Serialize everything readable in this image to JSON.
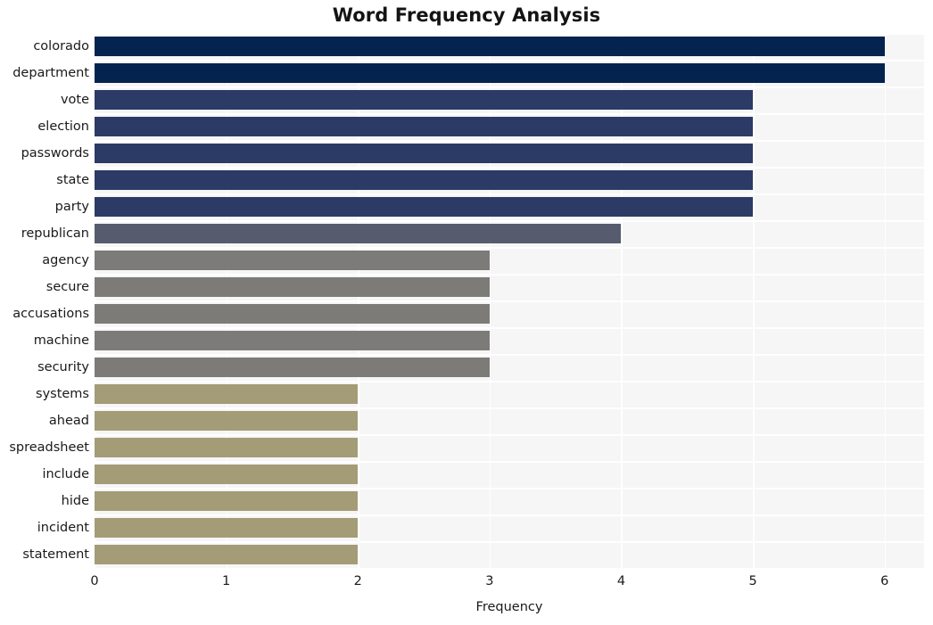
{
  "chart_data": {
    "type": "bar",
    "orientation": "horizontal",
    "title": "Word Frequency Analysis",
    "xlabel": "Frequency",
    "ylabel": "",
    "xlim": [
      0,
      6.3
    ],
    "xticks": [
      0,
      1,
      2,
      3,
      4,
      5,
      6
    ],
    "xtick_labels": [
      "0",
      "1",
      "2",
      "3",
      "4",
      "5",
      "6"
    ],
    "grid": true,
    "legend": false,
    "categories": [
      "colorado",
      "department",
      "vote",
      "election",
      "passwords",
      "state",
      "party",
      "republican",
      "agency",
      "secure",
      "accusations",
      "machine",
      "security",
      "systems",
      "ahead",
      "spreadsheet",
      "include",
      "hide",
      "incident",
      "statement"
    ],
    "values": [
      6,
      6,
      5,
      5,
      5,
      5,
      5,
      4,
      3,
      3,
      3,
      3,
      3,
      2,
      2,
      2,
      2,
      2,
      2,
      2
    ],
    "bar_colors": [
      "#05234f",
      "#05234f",
      "#2b3b66",
      "#2b3b66",
      "#2b3b66",
      "#2b3b66",
      "#2b3b66",
      "#565c6e",
      "#7c7b78",
      "#7c7b78",
      "#7c7b78",
      "#7c7b78",
      "#7c7b78",
      "#a39c76",
      "#a39c76",
      "#a39c76",
      "#a39c76",
      "#a39c76",
      "#a39c76",
      "#a39c76"
    ],
    "palette": {
      "dark_navy": "#05234f",
      "navy_blue": "#2b3b66",
      "slate": "#565c6e",
      "gray": "#7c7b78",
      "khaki": "#a39c76",
      "plot_background": "#f6f6f7",
      "grid_color": "#ffffff",
      "figure_background": "#ffffff",
      "text_color": "#1a1a1a"
    }
  }
}
